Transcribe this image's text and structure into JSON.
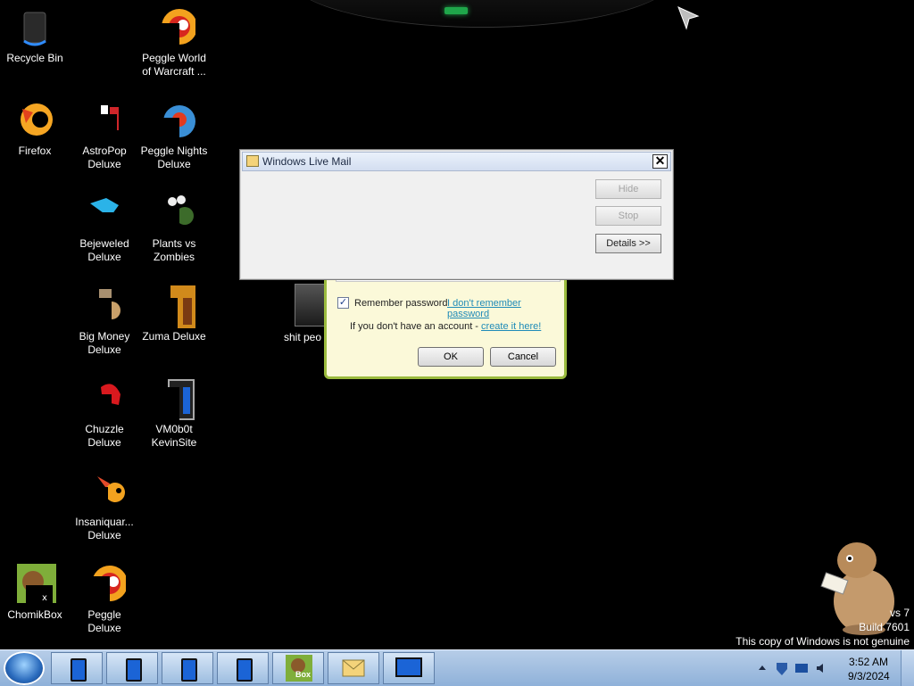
{
  "desktop": {
    "icons": [
      {
        "label": "Recycle Bin"
      },
      {
        "label": "Peggle World of Warcraft ..."
      },
      {
        "label": "Firefox"
      },
      {
        "label": "AstroPop Deluxe"
      },
      {
        "label": "Peggle Nights Deluxe"
      },
      {
        "label": "Bejeweled Deluxe"
      },
      {
        "label": "Plants vs Zombies"
      },
      {
        "label": "Big Money Deluxe"
      },
      {
        "label": "Zuma Deluxe"
      },
      {
        "label": "Chuzzle Deluxe"
      },
      {
        "label": "VM0b0t KevinSite"
      },
      {
        "label": "Insaniquar... Deluxe"
      },
      {
        "label": "ChomikBox"
      },
      {
        "label": "Peggle Deluxe"
      }
    ],
    "partial_item_label": "shit peo asked m"
  },
  "dialog": {
    "title": "Windows Live Mail",
    "close_glyph": "✕",
    "hide_label": "Hide",
    "stop_label": "Stop",
    "details_label": "Details >>"
  },
  "login": {
    "remember_label": "Remember password",
    "remember_checked": "✓",
    "forgot_link": "I don't remember password",
    "no_account_text": "If you don't have an account - ",
    "create_link": "create it here!",
    "ok_label": "OK",
    "cancel_label": "Cancel"
  },
  "watermark": {
    "line1": "vs 7",
    "line2": "Build 7601",
    "line3": "This copy of Windows is not genuine"
  },
  "taskbar": {
    "chomikbox_label": "Box",
    "clock_time": "3:52 AM",
    "clock_date": "9/3/2024"
  },
  "colors": {
    "taskbar": "#9fbde0",
    "login_border": "#9bbb3e",
    "link": "#1f8bb8"
  }
}
